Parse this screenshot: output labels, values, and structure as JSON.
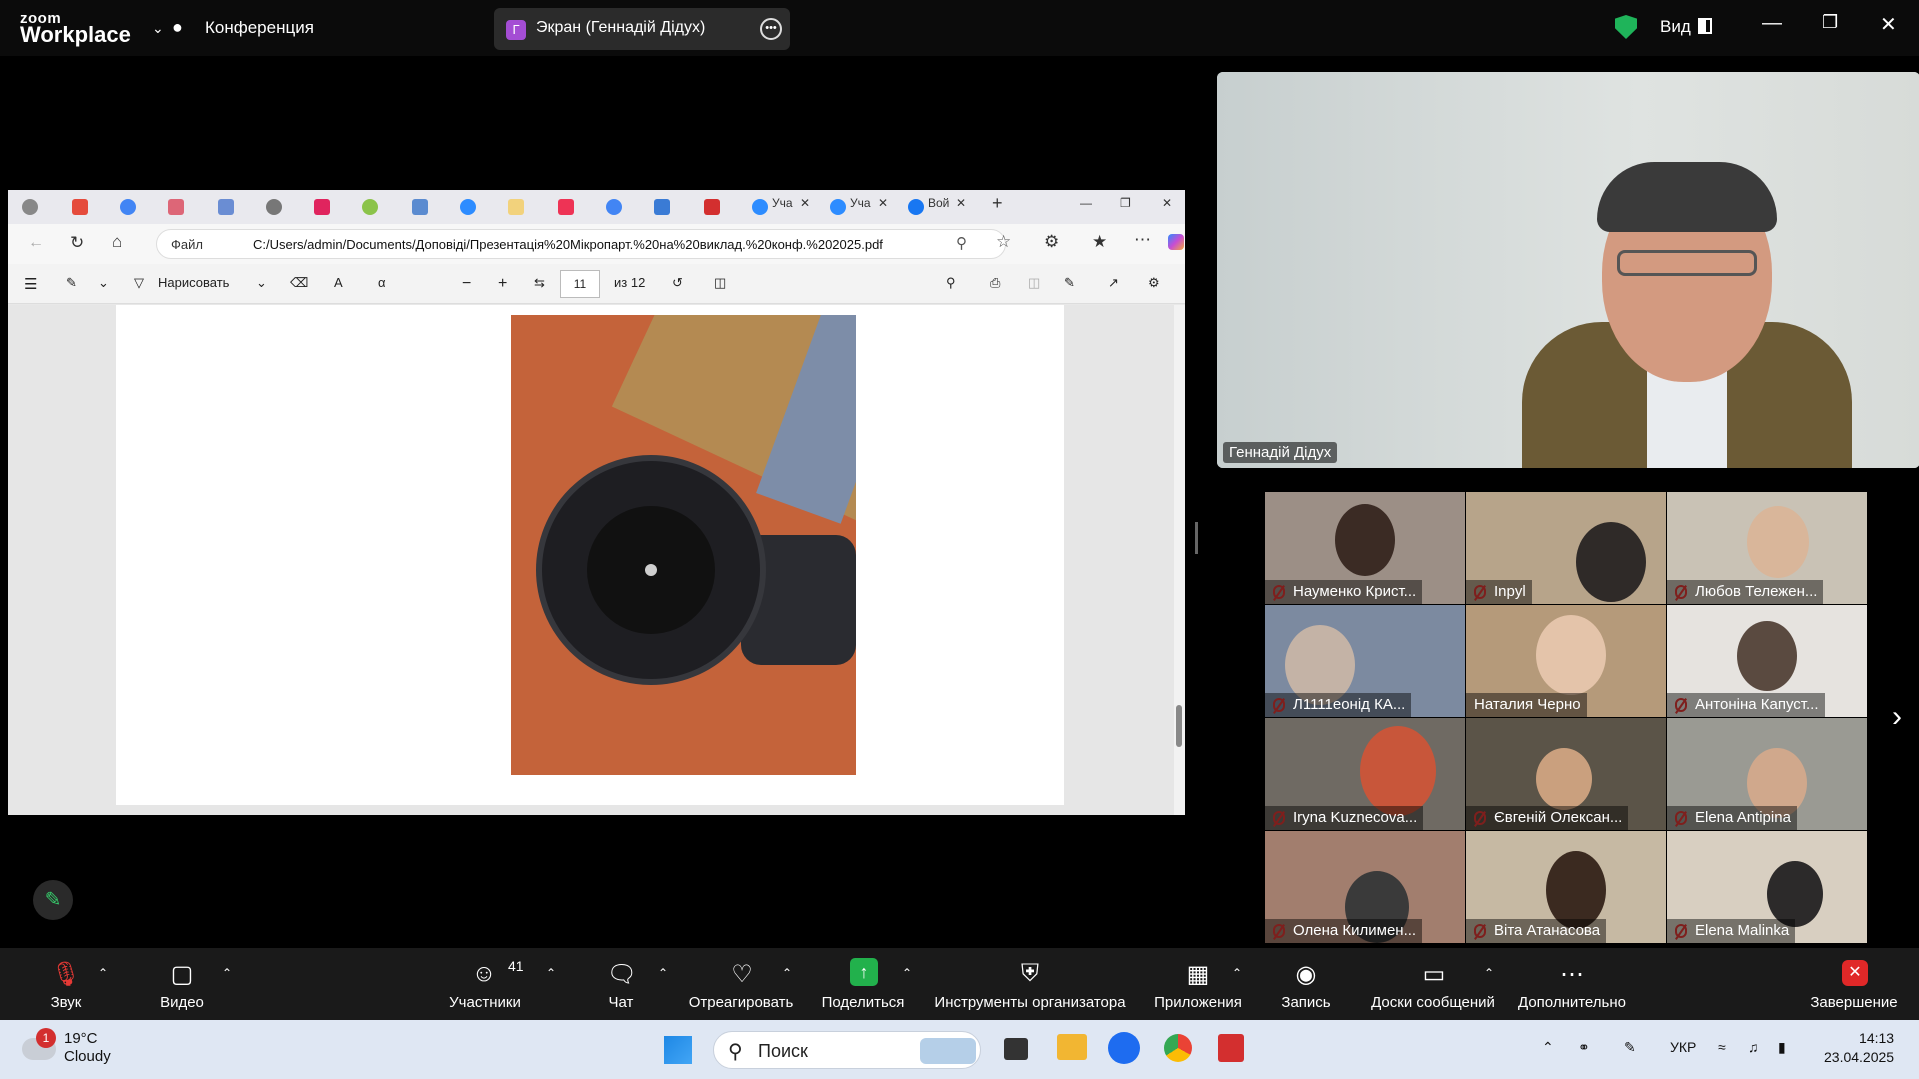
{
  "app": {
    "logo_small": "zoom",
    "logo_big": "Workplace",
    "meeting_label": "Конференция",
    "sharing_label": "Экран (Геннадій Дідух)",
    "sharing_avatar": "Г",
    "view_label": "Вид"
  },
  "browser": {
    "address_label": "Файл",
    "url": "C:/Users/admin/Documents/Доповіді/Презентація%20Мікропарт.%20на%20виклад.%20конф.%202025.pdf",
    "tabs": [
      {
        "label": "Уча"
      },
      {
        "label": "Уча"
      },
      {
        "label": "Вой"
      }
    ],
    "pdf_toolbar": {
      "draw_label": "Нарисовать",
      "page_current": "11",
      "page_total": "из 12"
    }
  },
  "speaker": {
    "name": "Геннадій Дідух"
  },
  "gallery": {
    "participants": [
      {
        "name": "Науменко Крист..."
      },
      {
        "name": "Inpyl"
      },
      {
        "name": "Любов Тележен..."
      },
      {
        "name": "Л1111еонід КА..."
      },
      {
        "name": "Наталия Черно"
      },
      {
        "name": "Антоніна Капуст..."
      },
      {
        "name": "Iryna Kuznecova..."
      },
      {
        "name": "Євгеній Олексан..."
      },
      {
        "name": "Elena Antipina"
      },
      {
        "name": "Олена Килимен..."
      },
      {
        "name": "Віта Атанасова"
      },
      {
        "name": "Elena Malinka"
      }
    ]
  },
  "toolbar": {
    "audio": "Звук",
    "video": "Видео",
    "participants": "Участники",
    "participants_count": "41",
    "chat": "Чат",
    "react": "Отреагировать",
    "share": "Поделиться",
    "host_tools": "Инструменты организатора",
    "apps": "Приложения",
    "record": "Запись",
    "whiteboards": "Доски сообщений",
    "more": "Дополнительно",
    "end": "Завершение"
  },
  "taskbar": {
    "weather_temp": "19°C",
    "weather_desc": "Cloudy",
    "weather_badge": "1",
    "search_label": "Поиск",
    "lang": "УКР",
    "time": "14:13",
    "date": "23.04.2025"
  },
  "colors": {
    "share_green": "#22b14c",
    "end_red": "#e02828",
    "shield_green": "#1fb45a"
  }
}
